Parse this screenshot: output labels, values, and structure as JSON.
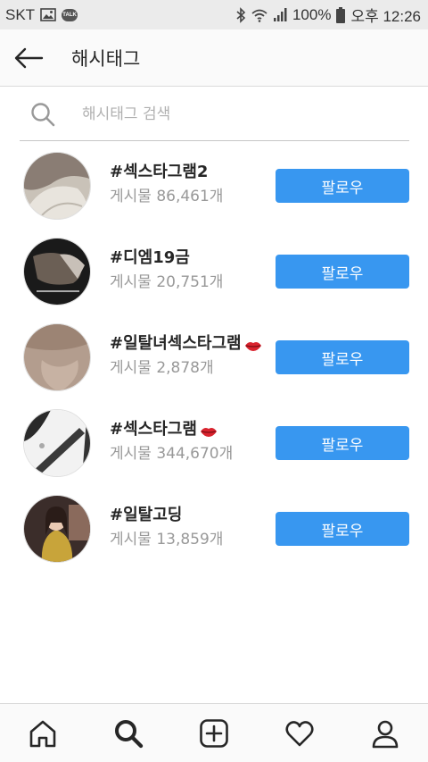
{
  "status_bar": {
    "carrier": "SKT",
    "talk_badge": "TALK",
    "battery": "100%",
    "time": "오후 12:26"
  },
  "header": {
    "title": "해시태그"
  },
  "search": {
    "placeholder": "해시태그 검색"
  },
  "tags": [
    {
      "name": "#섹스타그램2",
      "count": "게시물 86,461개",
      "follow_label": "팔로우",
      "emoji": ""
    },
    {
      "name": "#디엠19금",
      "count": "게시물 20,751개",
      "follow_label": "팔로우",
      "emoji": ""
    },
    {
      "name": "#일탈녀섹스타그램",
      "count": "게시물 2,878개",
      "follow_label": "팔로우",
      "emoji": "lips-icon"
    },
    {
      "name": "#섹스타그램",
      "count": "게시물 344,670개",
      "follow_label": "팔로우",
      "emoji": "lips-icon"
    },
    {
      "name": "#일탈고딩",
      "count": "게시물 13,859개",
      "follow_label": "팔로우",
      "emoji": ""
    }
  ],
  "bottom_nav": {
    "items": [
      "home-icon",
      "search-icon",
      "add-post-icon",
      "heart-icon",
      "profile-icon"
    ],
    "active": "search-icon"
  },
  "colors": {
    "follow_button": "#3897f0",
    "header_bg": "#fafafa",
    "status_bar_bg": "#ebebeb"
  }
}
